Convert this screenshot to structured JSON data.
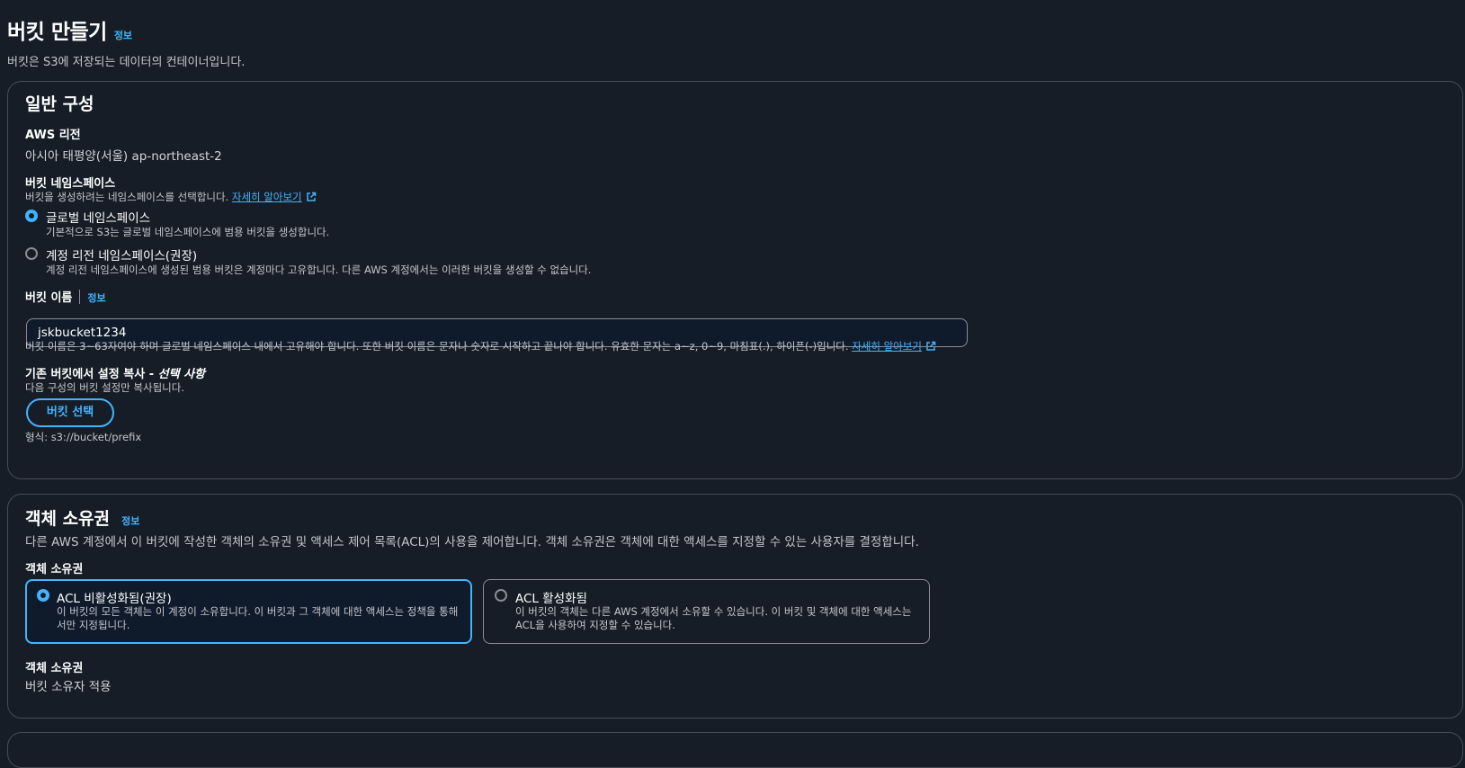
{
  "header": {
    "title": "버킷 만들기",
    "info_label": "정보",
    "description": "버킷은 S3에 저장되는 데이터의 컨테이너입니다."
  },
  "general": {
    "title": "일반 구성",
    "region_label": "AWS 리전",
    "region_value": "아시아 태평양(서울) ap-northeast-2",
    "namespace": {
      "label": "버킷 네임스페이스",
      "description": "버킷을 생성하려는 네임스페이스를 선택합니다.",
      "learn_more": "자세히 알아보기",
      "options": [
        {
          "label": "글로벌 네임스페이스",
          "description": "기본적으로 S3는 글로벌 네임스페이스에 범용 버킷을 생성합니다.",
          "selected": true
        },
        {
          "label": "계정 리전 네임스페이스(권장)",
          "description": "계정 리전 네임스페이스에 생성된 범용 버킷은 계정마다 고유합니다. 다른 AWS 계정에서는 이러한 버킷을 생성할 수 없습니다.",
          "selected": false
        }
      ]
    },
    "bucket_name": {
      "label": "버킷 이름",
      "info_label": "정보",
      "value": "jskbucket1234",
      "hint": "버킷 이름은 3~63자여야 하며 글로벌 네임스페이스 내에서 고유해야 합니다. 또한 버킷 이름은 문자나 숫자로 시작하고 끝나야 합니다. 유효한 문자는 a~z, 0~9, 마침표(.), 하이픈(-)입니다.",
      "learn_more": "자세히 알아보기"
    },
    "copy_settings": {
      "label": "기존 버킷에서 설정 복사 - ",
      "label_optional": "선택 사항",
      "description": "다음 구성의 버킷 설정만 복사됩니다.",
      "button": "버킷 선택",
      "format": "형식: s3://bucket/prefix"
    }
  },
  "ownership": {
    "title": "객체 소유권",
    "info_label": "정보",
    "description": "다른 AWS 계정에서 이 버킷에 작성한 객체의 소유권 및 액세스 제어 목록(ACL)의 사용을 제어합니다. 객체 소유권은 객체에 대한 액세스를 지정할 수 있는 사용자를 결정합니다.",
    "field_label": "객체 소유권",
    "options": [
      {
        "label": "ACL 비활성화됨(권장)",
        "desc_line1": "이 버킷의 모든 객체는 이 계정이 소유합니다. 이 버킷과 그 객체에 대한 액세스는 정책을 통해",
        "desc_line2": "서만 지정됩니다.",
        "selected": true
      },
      {
        "label": "ACL 활성화됨",
        "desc_line1": "이 버킷의 객체는 다른 AWS 계정에서 소유할 수 있습니다. 이 버킷 및 객체에 대한 액세스는",
        "desc_line2": "ACL을 사용하여 지정할 수 있습니다.",
        "selected": false
      }
    ],
    "result_label": "객체 소유권",
    "result_value": "버킷 소유자 적용"
  },
  "colors": {
    "background": "#161d26",
    "accent": "#42b4ff",
    "border": "#414d5c"
  }
}
